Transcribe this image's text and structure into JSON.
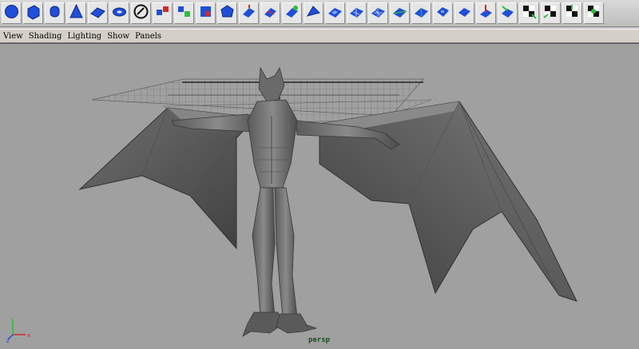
{
  "shelf": {
    "tools": [
      {
        "icon": "sphere-icon"
      },
      {
        "icon": "cube-icon"
      },
      {
        "icon": "cylinder-icon"
      },
      {
        "icon": "cone-icon"
      },
      {
        "icon": "plane-icon"
      },
      {
        "icon": "torus-icon"
      },
      {
        "icon": "circle-icon"
      },
      {
        "icon": "combine-icon"
      },
      {
        "icon": "separate-icon"
      },
      {
        "icon": "extract-icon"
      },
      {
        "icon": "smooth-icon"
      },
      {
        "icon": "extrude-face-icon"
      },
      {
        "icon": "split-polygon-icon"
      },
      {
        "icon": "append-polygon-icon"
      },
      {
        "icon": "cut-faces-icon"
      },
      {
        "icon": "bevel-icon"
      },
      {
        "icon": "bridge-icon"
      },
      {
        "icon": "subdivide-icon"
      },
      {
        "icon": "triangulate-icon"
      },
      {
        "icon": "quadrangulate-icon"
      },
      {
        "icon": "merge-edges-icon"
      },
      {
        "icon": "collapse-icon"
      },
      {
        "icon": "poke-face-icon"
      },
      {
        "icon": "wedge-face-icon"
      },
      {
        "icon": "uv-checker-icon"
      },
      {
        "icon": "uv-planar-icon"
      },
      {
        "icon": "uv-cylindrical-icon"
      },
      {
        "icon": "uv-spherical-icon"
      }
    ]
  },
  "menubar": {
    "view": "View",
    "shading": "Shading",
    "lighting": "Lighting",
    "show": "Show",
    "panels": "Panels"
  },
  "viewport": {
    "camera_label": "persp",
    "axis_x": "x",
    "axis_y": "y",
    "axis_z": "z"
  },
  "colors": {
    "viewport_bg": "#a0a0a0",
    "icon_blue": "#1f4fd8",
    "icon_green": "#2bbf3a",
    "icon_red": "#d22a2a"
  }
}
